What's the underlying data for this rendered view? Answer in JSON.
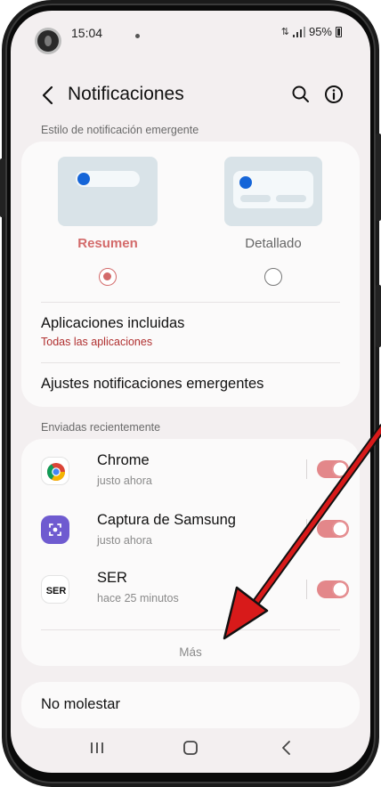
{
  "status_bar": {
    "time": "15:04",
    "battery": "95%"
  },
  "header": {
    "title": "Notificaciones",
    "icons": [
      "back-icon",
      "search-icon",
      "info-icon"
    ]
  },
  "popup_style": {
    "section_label": "Estilo de notificación emergente",
    "options": [
      {
        "label": "Resumen",
        "selected": true
      },
      {
        "label": "Detallado",
        "selected": false
      }
    ]
  },
  "settings": {
    "included_apps": {
      "title": "Aplicaciones incluidas",
      "subtitle": "Todas las aplicaciones"
    },
    "popup_settings": {
      "title": "Ajustes notificaciones emergentes"
    }
  },
  "recent": {
    "section_label": "Enviadas recientemente",
    "apps": [
      {
        "name": "Chrome",
        "time": "justo ahora",
        "enabled": true,
        "icon": "chrome-icon"
      },
      {
        "name": "Captura de Samsung",
        "time": "justo ahora",
        "enabled": true,
        "icon": "samsung-capture-icon"
      },
      {
        "name": "SER",
        "time": "hace 25 minutos",
        "enabled": true,
        "icon": "ser-icon"
      }
    ],
    "more_label": "Más"
  },
  "do_not_disturb": {
    "title": "No molestar"
  },
  "nav": [
    "recents-icon",
    "home-icon",
    "back-icon"
  ],
  "colors": {
    "accent": "#d36a6a",
    "toggle_on": "#e3878a",
    "subtitle_red": "#b03030",
    "preview_dot": "#1565d8",
    "arrow": "#d81a1a"
  }
}
